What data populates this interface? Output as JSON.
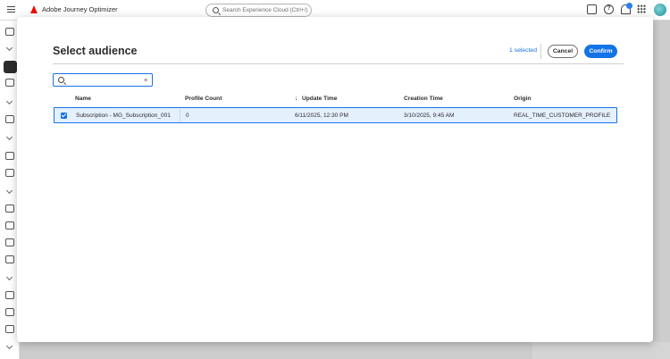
{
  "app": {
    "title": "Adobe Journey Optimizer",
    "search_placeholder": "Search Experience Cloud (Ctrl+/)",
    "help_glyph": "?"
  },
  "modal": {
    "title": "Select audience",
    "selected_count": "1 selected",
    "cancel_label": "Cancel",
    "confirm_label": "Confirm",
    "search_value": "",
    "clear_glyph": "×"
  },
  "table": {
    "columns": [
      "Name",
      "Profile Count",
      "Update Time",
      "Creation Time",
      "Origin"
    ],
    "sort_indicator": "↓",
    "sorted_column": "Update Time",
    "rows": [
      {
        "selected": true,
        "name": "Subscription - MG_Subscription_001",
        "profile_count": "0",
        "update_time": "6/11/2025, 12:30 PM",
        "creation_time": "3/10/2025, 9:45 AM",
        "origin": "REAL_TIME_CUSTOMER_PROFILE"
      }
    ]
  },
  "icons": {
    "top": [
      "hamburger-icon",
      "adobe-logo-icon",
      "search-icon",
      "chat-icon",
      "help-icon",
      "bell-icon",
      "apps-grid-icon",
      "avatar"
    ],
    "rail": [
      "home-icon",
      "campaign-icon",
      "journey-icon",
      "content-icon",
      "audience-icon",
      "data-icon"
    ]
  },
  "colors": {
    "accent": "#1473e6",
    "selected_row_bg": "#e5f0fd",
    "adobe_red": "#eb1000"
  }
}
